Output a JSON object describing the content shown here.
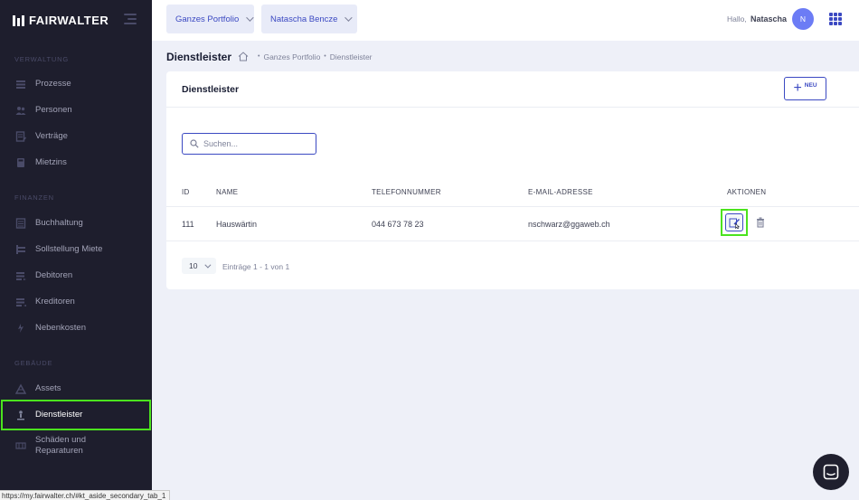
{
  "brand": {
    "name": "FAIRWALTER"
  },
  "sidebar": {
    "sections": [
      {
        "label": "VERWALTUNG"
      },
      {
        "label": "FINANZEN"
      },
      {
        "label": "GEBÄUDE"
      }
    ],
    "items": [
      {
        "label": "Prozesse",
        "icon": "processes-icon"
      },
      {
        "label": "Personen",
        "icon": "people-icon"
      },
      {
        "label": "Verträge",
        "icon": "contracts-icon"
      },
      {
        "label": "Mietzins",
        "icon": "rent-icon"
      },
      {
        "label": "Buchhaltung",
        "icon": "accounting-icon"
      },
      {
        "label": "Sollstellung Miete",
        "icon": "rent-debit-icon"
      },
      {
        "label": "Debitoren",
        "icon": "debtors-icon"
      },
      {
        "label": "Kreditoren",
        "icon": "creditors-icon"
      },
      {
        "label": "Nebenkosten",
        "icon": "utility-costs-icon"
      },
      {
        "label": "Assets",
        "icon": "assets-icon"
      },
      {
        "label": "Dienstleister",
        "icon": "service-provider-icon",
        "active": true
      },
      {
        "label_line1": "Schäden und",
        "label_line2": "Reparaturen",
        "icon": "damages-icon"
      }
    ]
  },
  "status_url": "https://my.fairwalter.ch/#kt_aside_secondary_tab_1",
  "header": {
    "portfolio": "Ganzes Portfolio",
    "person": "Natascha Bencze",
    "hello": "Hallo,",
    "username": "Natascha",
    "avatar_initial": "N",
    "accent": "#3b49c2"
  },
  "subheader": {
    "title": "Dienstleister",
    "breadcrumb": [
      "Ganzes Portfolio",
      "Dienstleister"
    ]
  },
  "card": {
    "title": "Dienstleister",
    "new_label": "NEU",
    "search_placeholder": "Suchen...",
    "columns": [
      "ID",
      "NAME",
      "TELEFONNUMMER",
      "E-MAIL-ADRESSE",
      "AKTIONEN"
    ],
    "rows": [
      {
        "id": "111",
        "name": "Hauswärtin",
        "phone": "044 673 78 23",
        "email": "nschwarz@ggaweb.ch"
      }
    ],
    "page_size": "10",
    "entries_info": "Einträge 1 - 1 von 1"
  }
}
